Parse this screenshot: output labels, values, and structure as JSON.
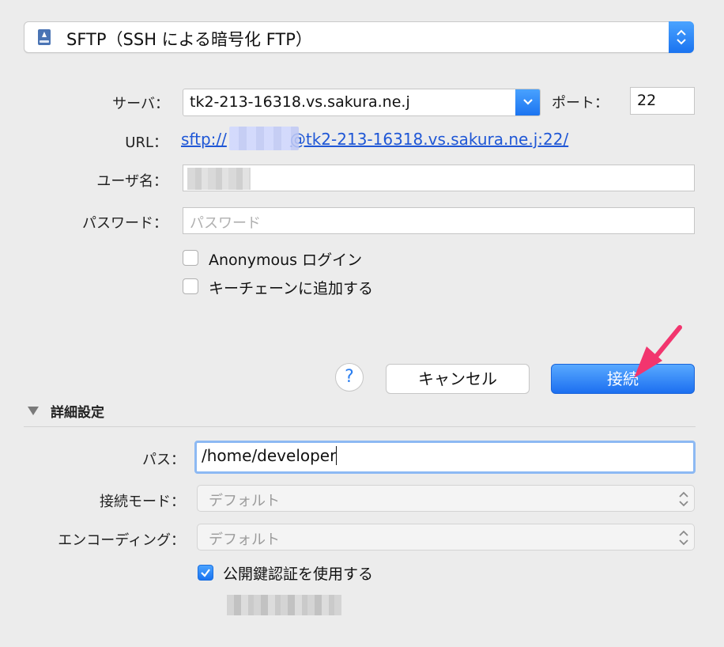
{
  "protocol": {
    "selected": "SFTP（SSH による暗号化 FTP）",
    "icon": "drive-icon"
  },
  "server": {
    "label": "サーバ：",
    "value": "tk2-213-16318.vs.sakura.ne.j"
  },
  "port": {
    "label": "ポート：",
    "value": "22"
  },
  "url": {
    "label": "URL：",
    "prefix": "sftp://",
    "suffix": "@tk2-213-16318.vs.sakura.ne.j:22/"
  },
  "username": {
    "label": "ユーザ名："
  },
  "password": {
    "label": "パスワード：",
    "placeholder": "パスワード"
  },
  "options": {
    "anonymous_label": "Anonymous ログイン",
    "anonymous_checked": false,
    "keychain_label": "キーチェーンに追加する",
    "keychain_checked": false
  },
  "buttons": {
    "help": "?",
    "cancel": "キャンセル",
    "connect": "接続"
  },
  "advanced": {
    "title": "詳細設定",
    "path_label": "パス：",
    "path_value": "/home/developer",
    "connect_mode_label": "接続モード：",
    "connect_mode_value": "デフォルト",
    "encoding_label": "エンコーディング：",
    "encoding_value": "デフォルト",
    "pubkey_label": "公開鍵認証を使用する",
    "pubkey_checked": true
  },
  "colors": {
    "accent": "#1a73f0",
    "link": "#1f57d6",
    "annotation_arrow": "#f2356e"
  }
}
